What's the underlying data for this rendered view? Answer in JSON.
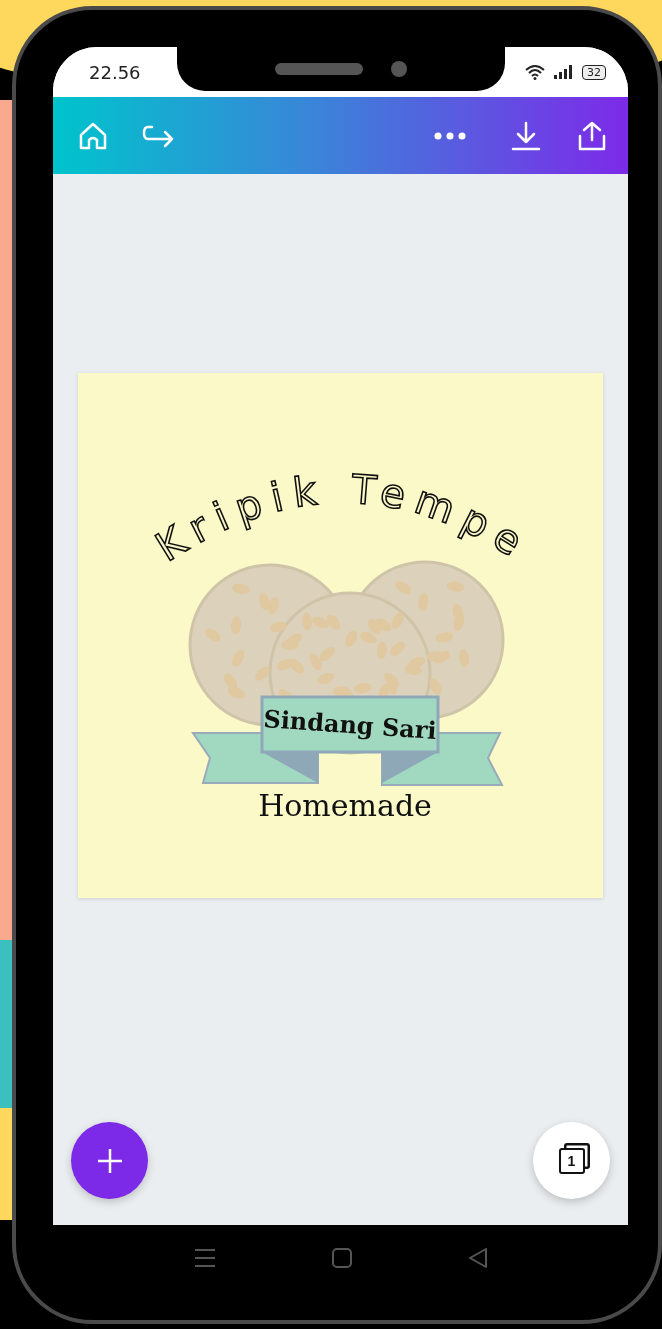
{
  "status_bar": {
    "time": "22.56",
    "battery": "32"
  },
  "design": {
    "title": "Kripik Tempe",
    "ribbon_text": "Sindang Sari",
    "subtitle": "Homemade"
  },
  "page_button": {
    "count": "1"
  }
}
